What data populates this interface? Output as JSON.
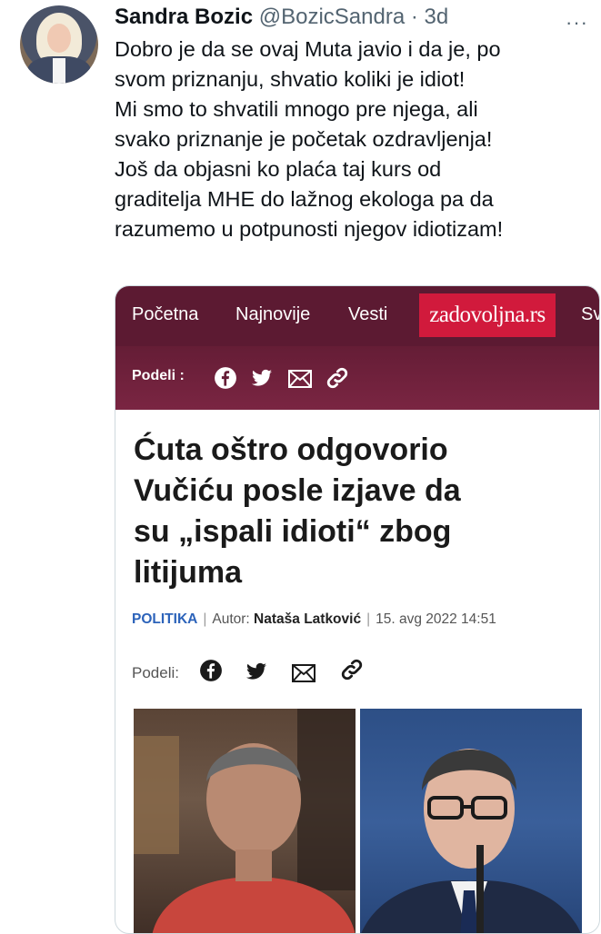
{
  "tweet": {
    "display_name": "Sandra Bozic",
    "handle": "@BozicSandra",
    "separator": "·",
    "time": "3d",
    "more_label": "···",
    "lines": [
      "Dobro je da se ovaj Muta javio i da je, po",
      "svom priznanju, shvatio koliki je idiot!",
      "Mi smo to shvatili mnogo pre njega, ali",
      "svako priznanje je početak ozdravljenja!",
      "Još da objasni ko plaća taj kurs od",
      "graditelja MHE do lažnog ekologa pa da",
      "razumemo u potpunosti njegov idiotizam!"
    ]
  },
  "article": {
    "nav": [
      "Početna",
      "Najnovije",
      "Vesti"
    ],
    "nav_overflow": "Sv",
    "logo_text": "zadovoljna.rs",
    "share_label": "Podeli :",
    "headline_lines": [
      "Ćuta oštro odgovorio",
      "Vučiću posle izjave da",
      "su „ispali idioti“ zbog",
      "litijuma"
    ],
    "category": "POLITIKA",
    "author_label": "Autor:",
    "author": "Nataša Latković",
    "date": "15. avg 2022 14:51",
    "share_label_2": "Podeli:",
    "icons": [
      "facebook-icon",
      "twitter-icon",
      "email-icon",
      "link-icon"
    ]
  },
  "colors": {
    "nav_bg": "#5c1a32",
    "logo_bg": "#d11a3c",
    "category": "#2c63ba",
    "text": "#0f1419",
    "muted": "#536471"
  }
}
